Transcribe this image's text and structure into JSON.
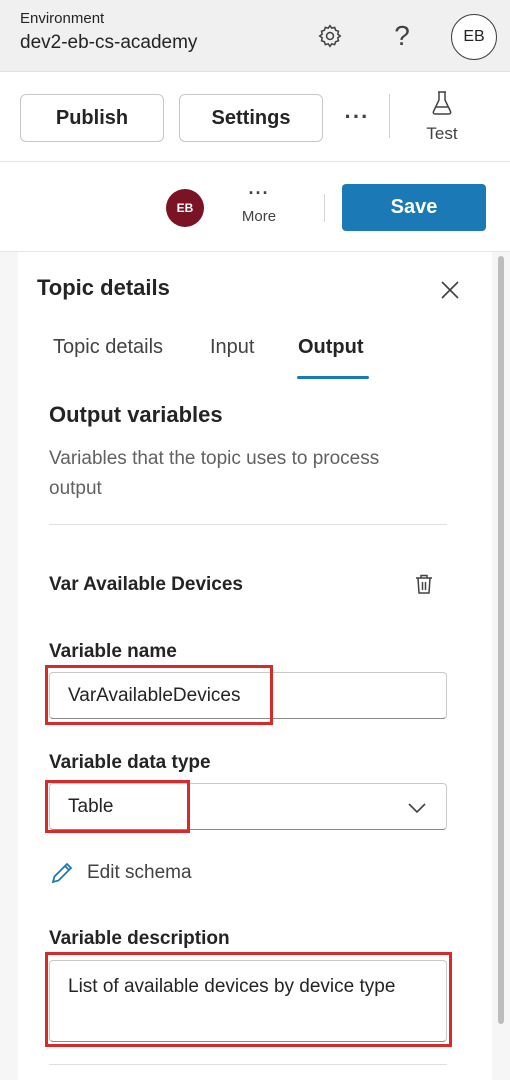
{
  "environment": {
    "label": "Environment",
    "name": "dev2-eb-cs-academy",
    "user_initials": "EB",
    "help_glyph": "?"
  },
  "toolbar": {
    "publish_label": "Publish",
    "settings_label": "Settings",
    "overflow_glyph": "···",
    "test_label": "Test"
  },
  "save_bar": {
    "avatar_initials": "EB",
    "avatar_color": "#7a1323",
    "more_glyph": "···",
    "more_label": "More",
    "save_label": "Save",
    "accent_color": "#1b79b5"
  },
  "panel": {
    "title": "Topic details",
    "tabs": [
      {
        "label": "Topic details",
        "selected": false
      },
      {
        "label": "Input",
        "selected": false
      },
      {
        "label": "Output",
        "selected": true
      }
    ],
    "section_title": "Output variables",
    "section_description": "Variables that the topic uses to process output",
    "variable": {
      "title": "Var Available Devices",
      "name_label": "Variable name",
      "name_value": "VarAvailableDevices",
      "type_label": "Variable data type",
      "type_value": "Table",
      "edit_schema_label": "Edit schema",
      "description_label": "Variable description",
      "description_value": "List of available devices by device type"
    },
    "highlight_color": "#d42b2b"
  }
}
